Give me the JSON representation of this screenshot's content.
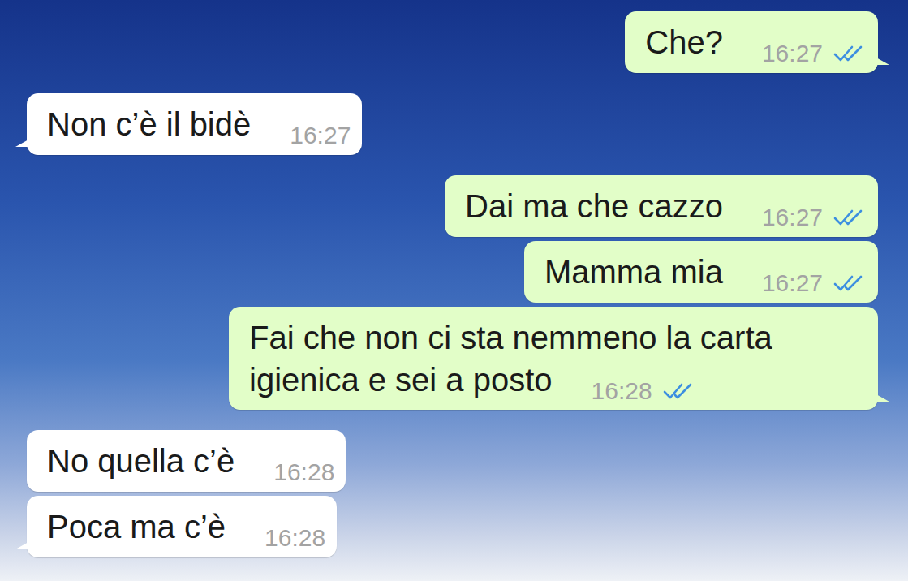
{
  "chat": {
    "messages": [
      {
        "kind": "outgoing",
        "text": "Che?",
        "time": "16:27",
        "read": true
      },
      {
        "kind": "incoming",
        "text": "Non c’è il bidè",
        "time": "16:27"
      },
      {
        "kind": "outgoing",
        "text": "Dai ma che cazzo",
        "time": "16:27",
        "read": true
      },
      {
        "kind": "outgoing",
        "text": "Mamma mia",
        "time": "16:27",
        "read": true
      },
      {
        "kind": "outgoing",
        "text": "Fai che non ci sta nemmeno la carta igienica e sei a posto",
        "time": "16:28",
        "read": true
      },
      {
        "kind": "incoming",
        "text": "No quella c’è",
        "time": "16:28"
      },
      {
        "kind": "incoming",
        "text": "Poca ma c’è",
        "time": "16:28"
      }
    ]
  }
}
